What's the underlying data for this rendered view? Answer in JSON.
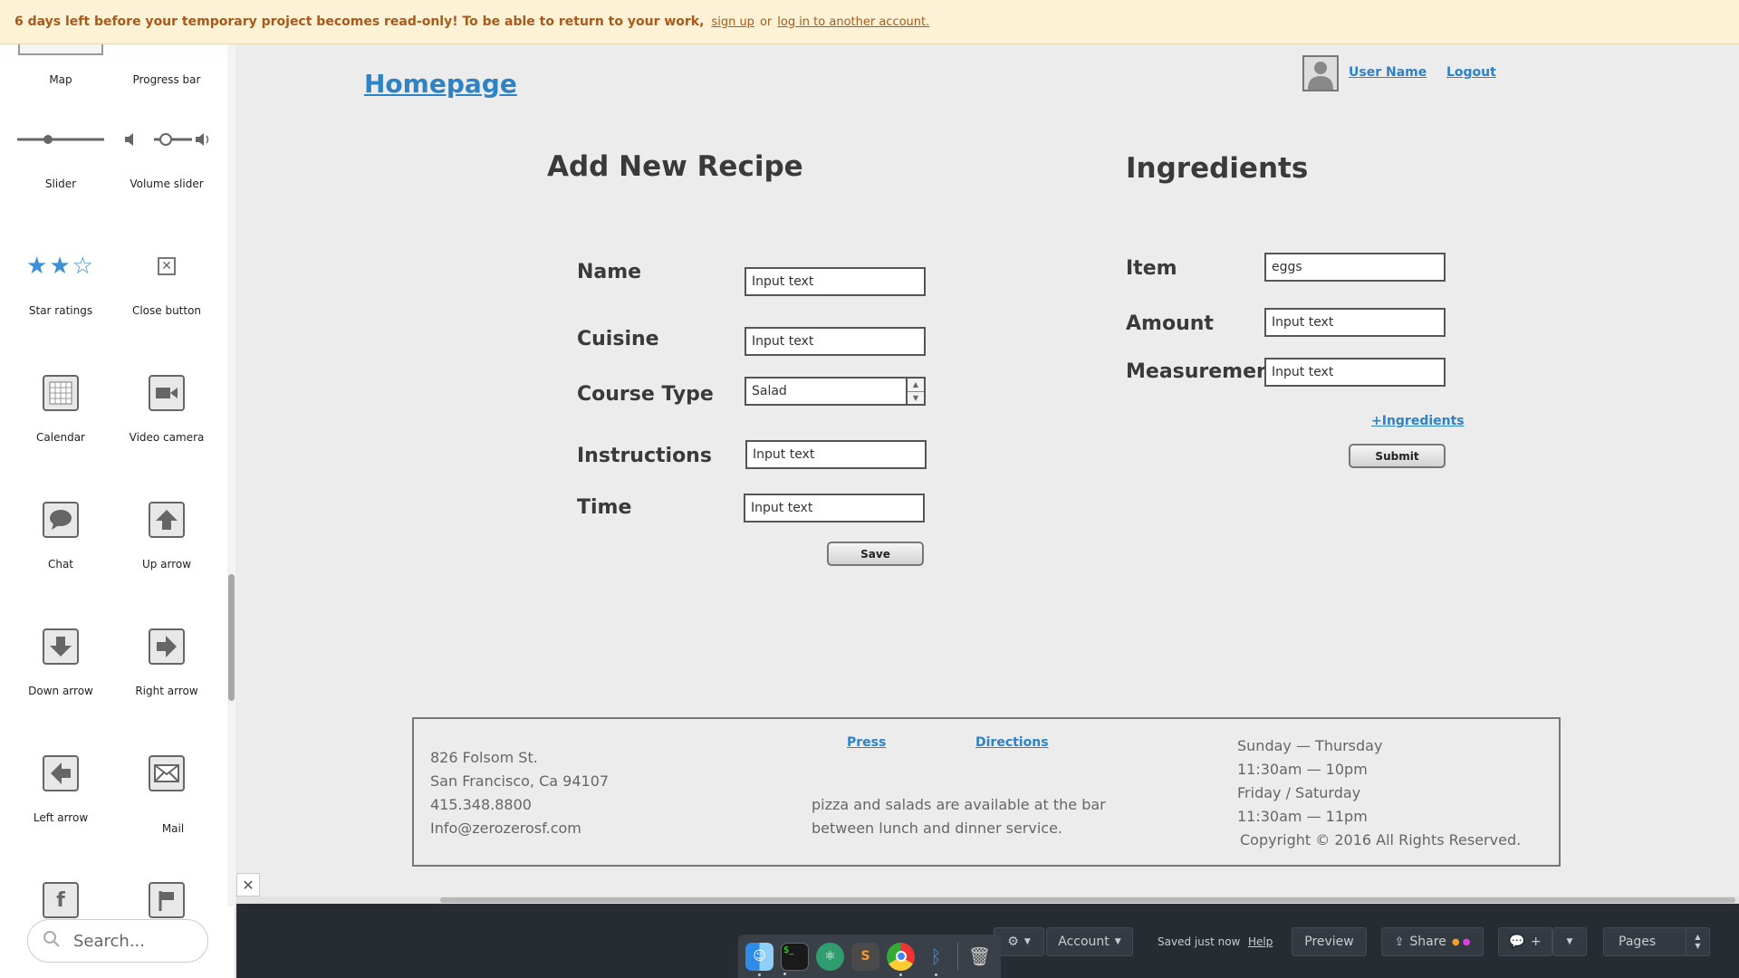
{
  "banner": {
    "message": "6 days left before your temporary project becomes read-only! To be able to return to your work,",
    "signup": "sign up",
    "or": "or",
    "login": "log in to another account."
  },
  "sidebar": {
    "items": [
      {
        "label": "Map",
        "icon": "map-icon"
      },
      {
        "label": "Progress bar",
        "icon": "progress-bar-icon"
      },
      {
        "label": "Slider",
        "icon": "slider-icon"
      },
      {
        "label": "Volume slider",
        "icon": "volume-slider-icon"
      },
      {
        "label": "Star ratings",
        "icon": "star-rating-icon"
      },
      {
        "label": "Close button",
        "icon": "close-button-icon"
      },
      {
        "label": "Calendar",
        "icon": "calendar-icon"
      },
      {
        "label": "Video camera",
        "icon": "video-camera-icon"
      },
      {
        "label": "Chat",
        "icon": "chat-icon"
      },
      {
        "label": "Up arrow",
        "icon": "up-arrow-icon"
      },
      {
        "label": "Down arrow",
        "icon": "down-arrow-icon"
      },
      {
        "label": "Right arrow",
        "icon": "right-arrow-icon"
      },
      {
        "label": "Left arrow",
        "icon": "left-arrow-icon"
      },
      {
        "label": "Mail",
        "icon": "mail-icon"
      }
    ],
    "search_placeholder": "Search..."
  },
  "page": {
    "homepage_link": "Homepage",
    "user_name": "User Name",
    "logout": "Logout",
    "recipe": {
      "title": "Add New Recipe",
      "name_label": "Name",
      "cuisine_label": "Cuisine",
      "course_label": "Course Type",
      "instructions_label": "Instructions",
      "time_label": "Time",
      "name_value": "Input text",
      "cuisine_value": "Input text",
      "course_value": "Salad",
      "instructions_value": "Input text",
      "time_value": "Input text",
      "save": "Save"
    },
    "ingredients": {
      "title": "Ingredients",
      "item_label": "Item",
      "amount_label": "Amount",
      "measurement_label": "Measurement",
      "item_value": "eggs",
      "amount_value": "Input text",
      "measurement_value": "Input text",
      "add_link": "+Ingredients",
      "submit": "Submit"
    },
    "footer": {
      "address": [
        "826 Folsom St.",
        "San Francisco, Ca 94107",
        "415.348.8800",
        "Info@zerozerosf.com"
      ],
      "press": "Press",
      "directions": "Directions",
      "blurb": [
        "pizza and salads are available at the bar",
        "between lunch and dinner service."
      ],
      "hours": [
        "Sunday — Thursday",
        "11:30am — 10pm",
        "Friday / Saturday",
        "11:30am — 11pm"
      ],
      "copyright": "Copyright © 2016 All Rights Reserved."
    }
  },
  "toolbar": {
    "account": "Account",
    "saved": "Saved just now",
    "help": "Help",
    "preview": "Preview",
    "share": "Share",
    "comment_plus": "+",
    "pages": "Pages"
  },
  "colors": {
    "link": "#2e82c6",
    "banner_bg": "#fdf2d6",
    "banner_text": "#a85a1a",
    "toolbar_bg": "#272c32"
  }
}
